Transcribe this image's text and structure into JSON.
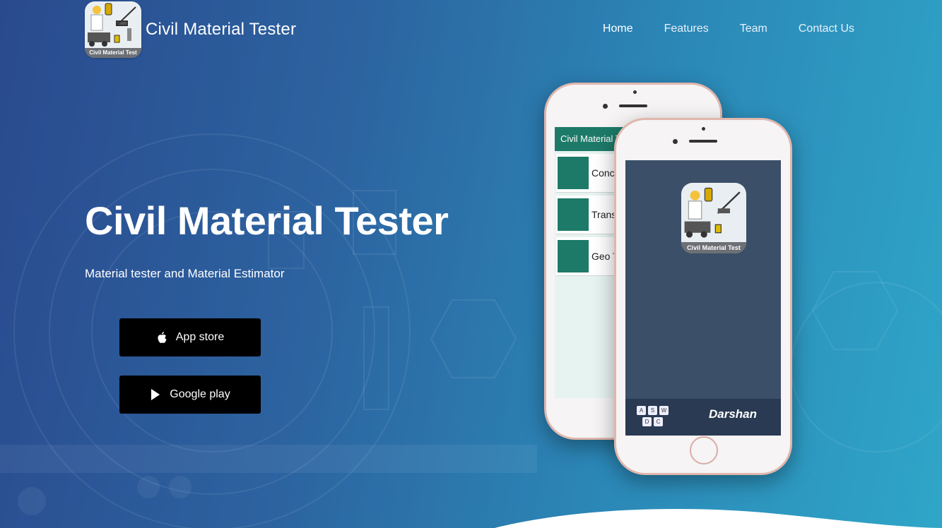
{
  "header": {
    "brand": "Civil Material Tester",
    "logo_caption": "Civil Material Test",
    "nav": [
      {
        "label": "Home",
        "active": true
      },
      {
        "label": "Features"
      },
      {
        "label": "Team"
      },
      {
        "label": "Contact Us"
      }
    ]
  },
  "hero": {
    "title": "Civil Material Tester",
    "subtitle": "Material tester and Material Estimator",
    "buttons": [
      {
        "label": "App store",
        "icon": "apple-icon"
      },
      {
        "label": "Google play",
        "icon": "play-icon"
      }
    ]
  },
  "phone_back": {
    "appbar_title": "Civil Material T",
    "rows": [
      "Concr",
      "Transp",
      "Geo T"
    ]
  },
  "phone_front": {
    "app_icon_caption": "Civil Material Test",
    "keys": [
      "A",
      "S",
      "W",
      "D",
      "C"
    ],
    "footer_brand": "Darshan"
  },
  "colors": {
    "bg_start": "#2a4a8e",
    "bg_end": "#2fa6c8",
    "accent_green": "#1d7a68",
    "button_bg": "#000000"
  }
}
